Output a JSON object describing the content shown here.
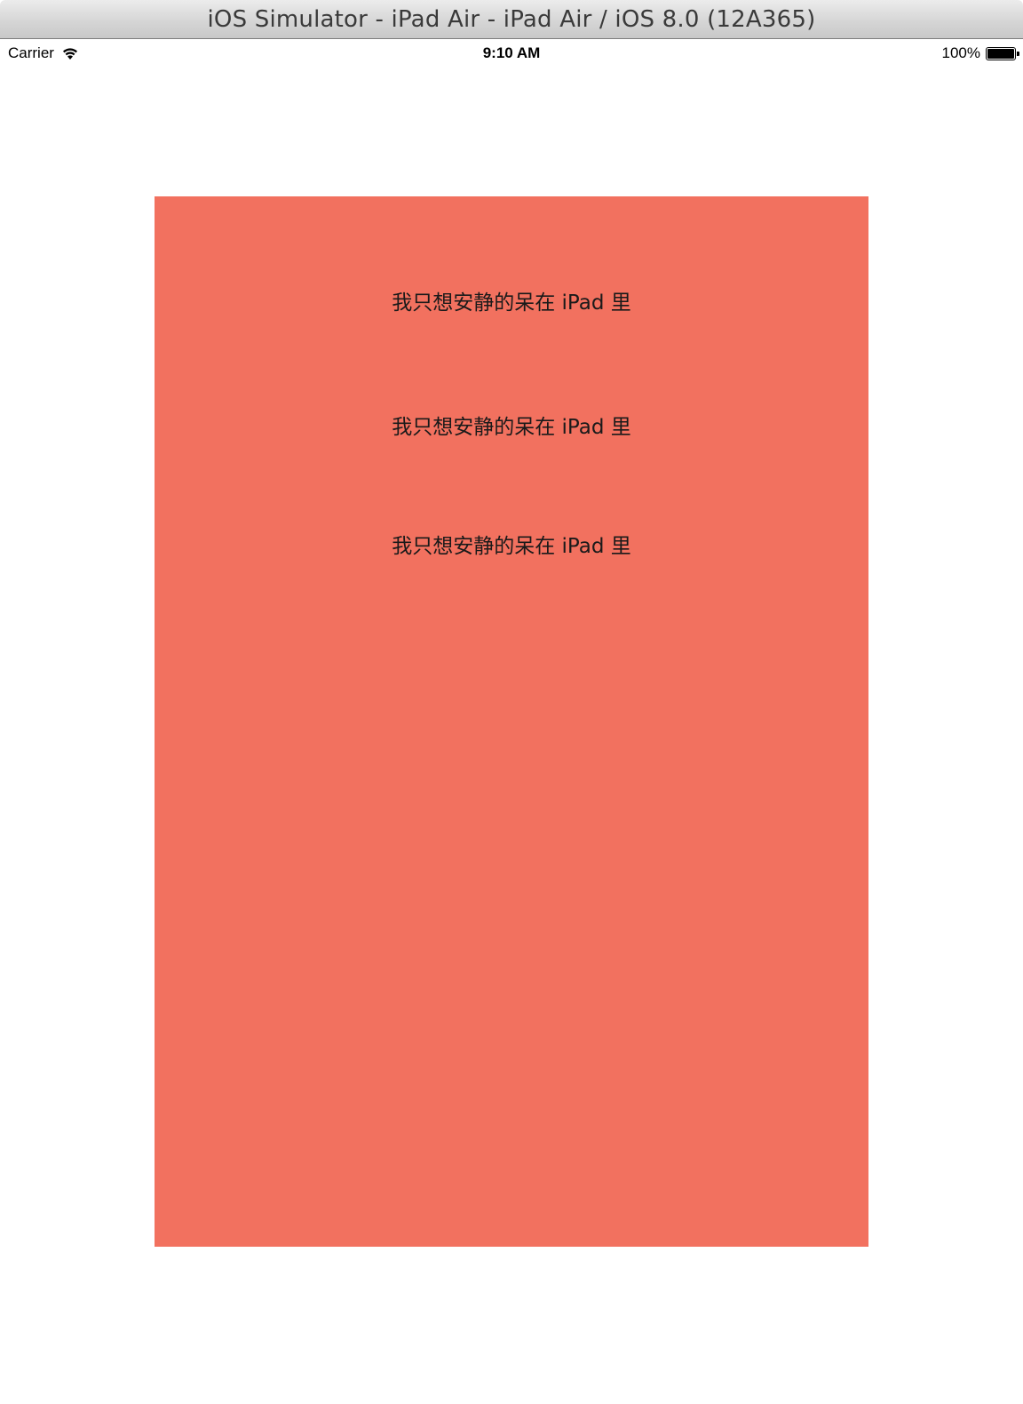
{
  "window": {
    "title": "iOS Simulator - iPad Air - iPad Air / iOS 8.0 (12A365)"
  },
  "statusbar": {
    "carrier": "Carrier",
    "wifi_icon": "wifi-icon",
    "time": "9:10 AM",
    "battery_percent": "100%",
    "battery_level": 1.0,
    "battery_icon": "battery-icon"
  },
  "panel": {
    "background_color": "#f2715f",
    "labels": [
      "我只想安静的呆在 iPad 里",
      "我只想安静的呆在 iPad 里",
      "我只想安静的呆在 iPad 里"
    ]
  }
}
